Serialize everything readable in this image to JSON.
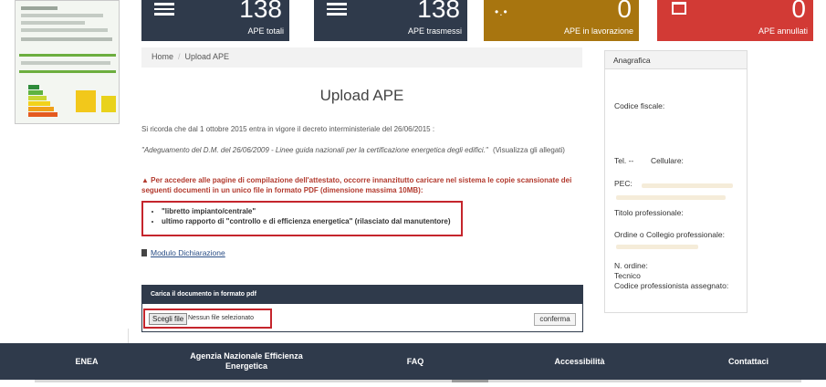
{
  "stats": [
    {
      "value": "138",
      "label": "APE totali",
      "color": "#2f3a4b"
    },
    {
      "value": "138",
      "label": "APE trasmessi",
      "color": "#2f3a4b"
    },
    {
      "value": "0",
      "label": "APE in lavorazione",
      "color": "#a8750f"
    },
    {
      "value": "0",
      "label": "APE annullati",
      "color": "#d23a35"
    }
  ],
  "breadcrumb": {
    "home": "Home",
    "current": "Upload APE"
  },
  "main": {
    "title": "Upload APE",
    "notice": "Si ricorda che dal 1 ottobre 2015 entra in vigore il decreto interministeriale del 26/06/2015 :",
    "decree_quote": "\"Adeguamento del D.M. del 26/06/2009 - Linee guida nazionali per la certificazione energetica degli edifici.\"",
    "attachments_link": "(Visualizza gli allegati)",
    "warning": "Per accedere alle pagine di compilazione dell'attestato, occorre innanzitutto caricare nel sistema le copie scansionate dei seguenti documenti in un unico file in formato PDF (dimensione massima 10MB):",
    "documents": [
      "\"libretto impianto/centrale\"",
      "ultimo rapporto di \"controllo e di efficienza energetica\" (rilasciato dal manutentore)"
    ],
    "modulo_link": "Modulo Dichiarazione"
  },
  "upload": {
    "header": "Carica il documento in formato pdf",
    "choose_button": "Scegli file",
    "no_file": "Nessun file selezionato",
    "confirm_button": "conferma"
  },
  "sidebar": {
    "title": "Anagrafica",
    "codice_fiscale": "Codice fiscale:",
    "tel": "Tel. --",
    "cellulare": "Cellulare:",
    "pec": "PEC:",
    "titolo": "Titolo professionale:",
    "ordine": "Ordine o Collegio professionale:",
    "n_ordine": "N. ordine:",
    "tecnico": "Tecnico",
    "codice_prof": "Codice professionista assegnato:"
  },
  "footer": [
    {
      "label": "ENEA"
    },
    {
      "label": "Agenzia Nazionale Efficienza Energetica"
    },
    {
      "label": "FAQ"
    },
    {
      "label": "Accessibilità"
    },
    {
      "label": "Contattaci"
    }
  ]
}
